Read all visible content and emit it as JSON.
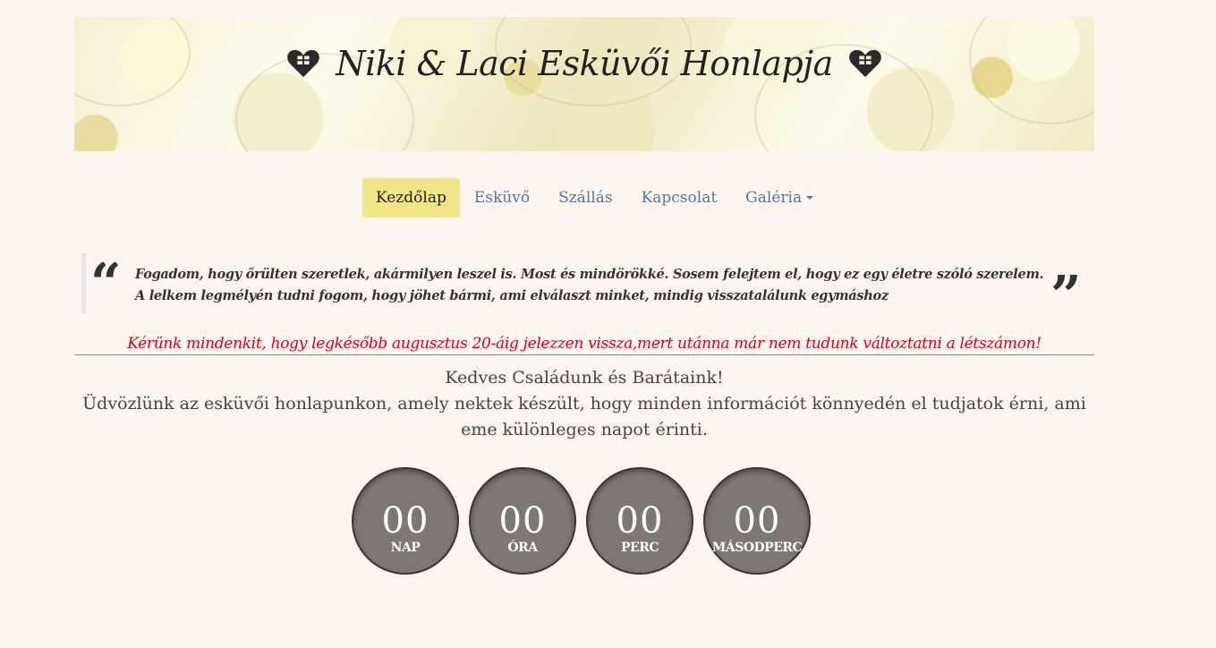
{
  "header": {
    "title": "Niki & Laci Esküvői Honlapja",
    "left_icon": "heart-gift-icon",
    "right_icon": "heart-gift-icon"
  },
  "nav": {
    "items": [
      {
        "label": "Kezdőlap"
      },
      {
        "label": "Esküvő"
      },
      {
        "label": "Szállás"
      },
      {
        "label": "Kapcsolat"
      },
      {
        "label": "Galéria"
      }
    ],
    "active_color": "#f1e58a",
    "link_color": "#4a79a8"
  },
  "quote": {
    "open_mark": "“",
    "close_mark": "”",
    "text": "Fogadom, hogy őrülten szeretlek, akármilyen leszel is. Most és mindörökké. Sosem felejtem el, hogy ez egy életre szóló szerelem. A lelkem legmélyén tudni fogom, hogy jöhet bármi, ami elválaszt minket, mindig visszatalálunk egymáshoz"
  },
  "notice": {
    "text": "Kérünk mindenkit, hogy legkésőbb augusztus 20-áig jelezzen vissza,mert utánna már nem tudunk változtatni a létszámon!",
    "color": "#d0021b"
  },
  "welcome": {
    "line1": "Kedves Családunk és Barátaink!",
    "line2": "Üdvözlünk az esküvői honlapunkon, amely nektek készült, hogy minden információt könnyedén el tudjatok érni, ami eme különleges napot érinti."
  },
  "countdown": {
    "days": {
      "value": "00",
      "label": "NAP"
    },
    "hours": {
      "value": "00",
      "label": "ÓRA"
    },
    "minutes": {
      "value": "00",
      "label": "PERC"
    },
    "seconds": {
      "value": "00",
      "label": "MÁSODPERC"
    }
  }
}
